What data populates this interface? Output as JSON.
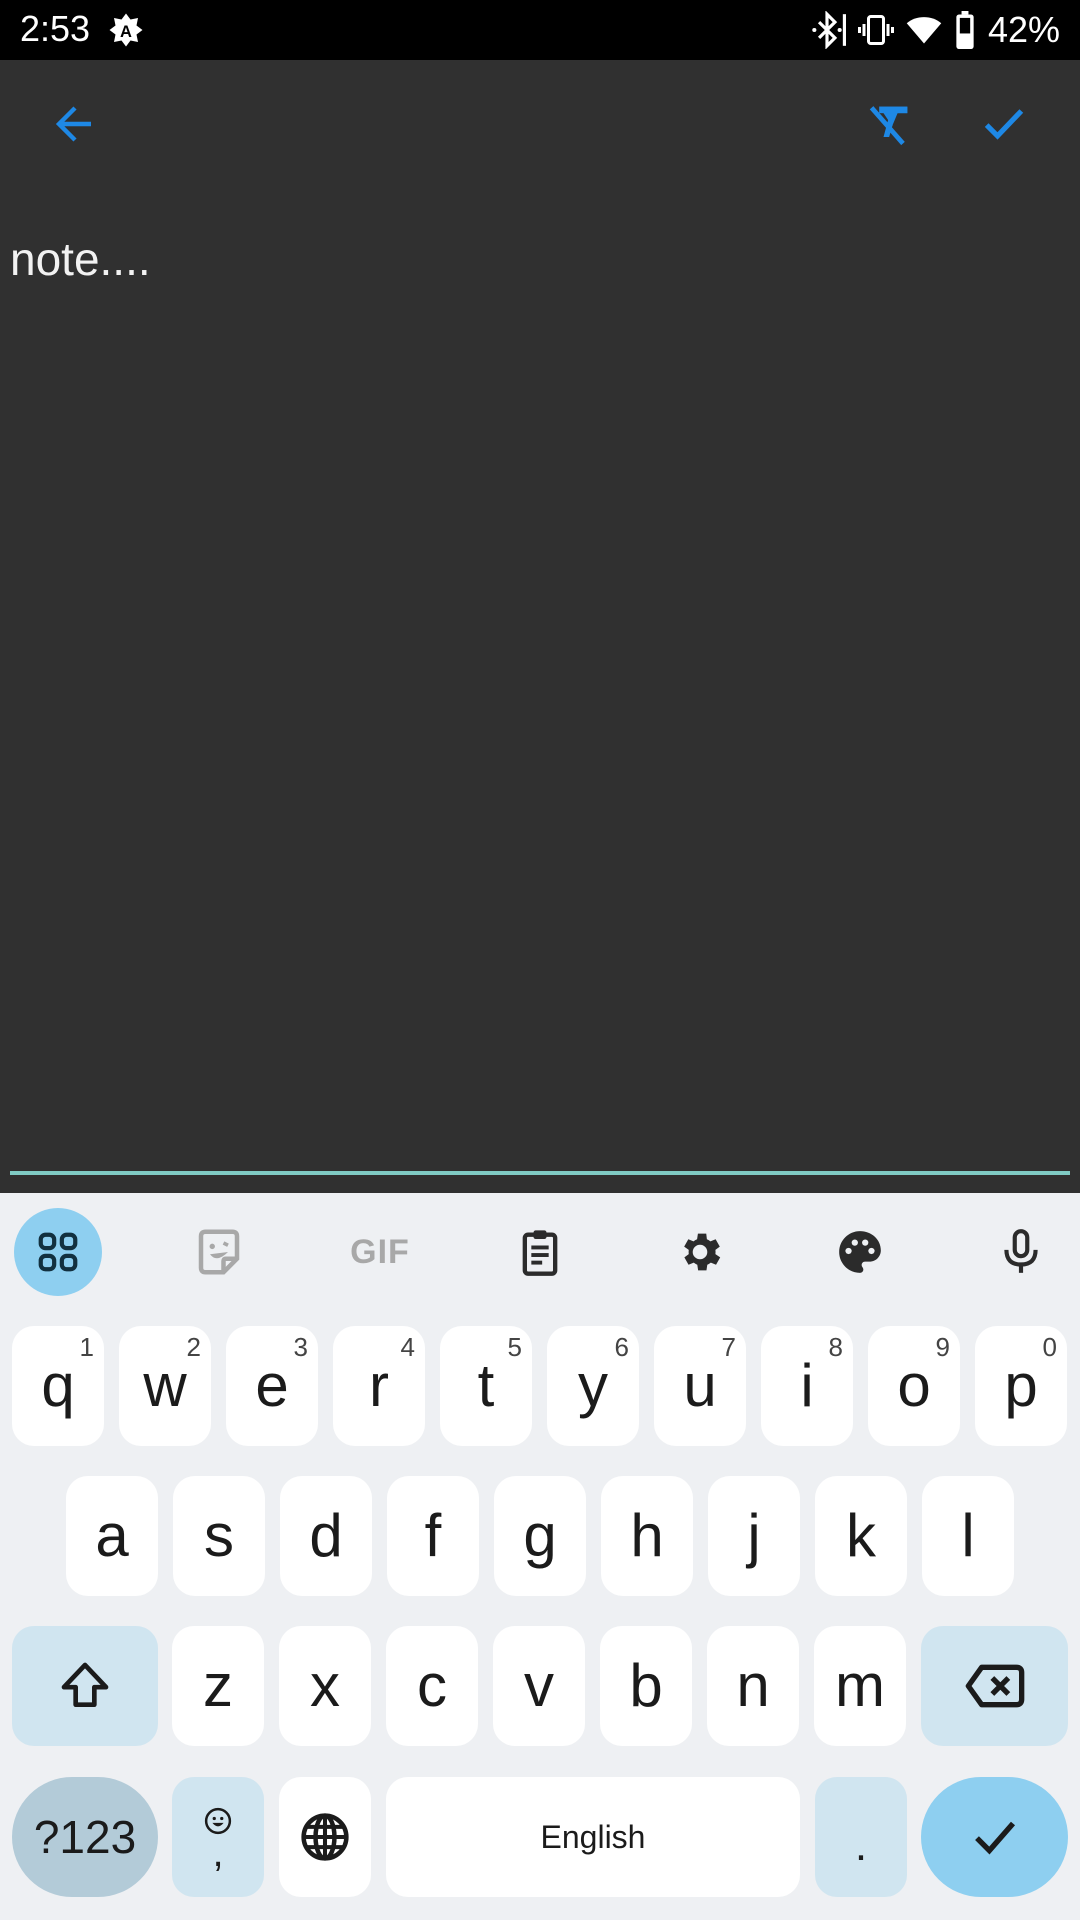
{
  "status_bar": {
    "time": "2:53",
    "left_icons": [
      "auto-brightness-icon"
    ],
    "right_icons": [
      "bluetooth-icon",
      "vibrate-icon",
      "wifi-icon",
      "battery-icon"
    ],
    "battery_percent": "42%"
  },
  "app_bar": {
    "back": "back-arrow-icon",
    "actions": [
      "clear-formatting-icon",
      "check-icon"
    ],
    "accent_color": "#1e88e5"
  },
  "editor": {
    "text": "note....",
    "underline_color": "#80cbc4"
  },
  "keyboard": {
    "toolbar": [
      "apps-grid-icon",
      "sticker-icon",
      "gif-icon",
      "clipboard-icon",
      "settings-icon",
      "theme-palette-icon",
      "microphone-icon"
    ],
    "gif_label": "GIF",
    "row1": [
      {
        "ch": "q",
        "sup": "1"
      },
      {
        "ch": "w",
        "sup": "2"
      },
      {
        "ch": "e",
        "sup": "3"
      },
      {
        "ch": "r",
        "sup": "4"
      },
      {
        "ch": "t",
        "sup": "5"
      },
      {
        "ch": "y",
        "sup": "6"
      },
      {
        "ch": "u",
        "sup": "7"
      },
      {
        "ch": "i",
        "sup": "8"
      },
      {
        "ch": "o",
        "sup": "9"
      },
      {
        "ch": "p",
        "sup": "0"
      }
    ],
    "row2": [
      "a",
      "s",
      "d",
      "f",
      "g",
      "h",
      "j",
      "k",
      "l"
    ],
    "row3": [
      "z",
      "x",
      "c",
      "v",
      "b",
      "n",
      "m"
    ],
    "symbols_label": "?123",
    "comma_label": ",",
    "space_label": "English",
    "period_label": "."
  }
}
